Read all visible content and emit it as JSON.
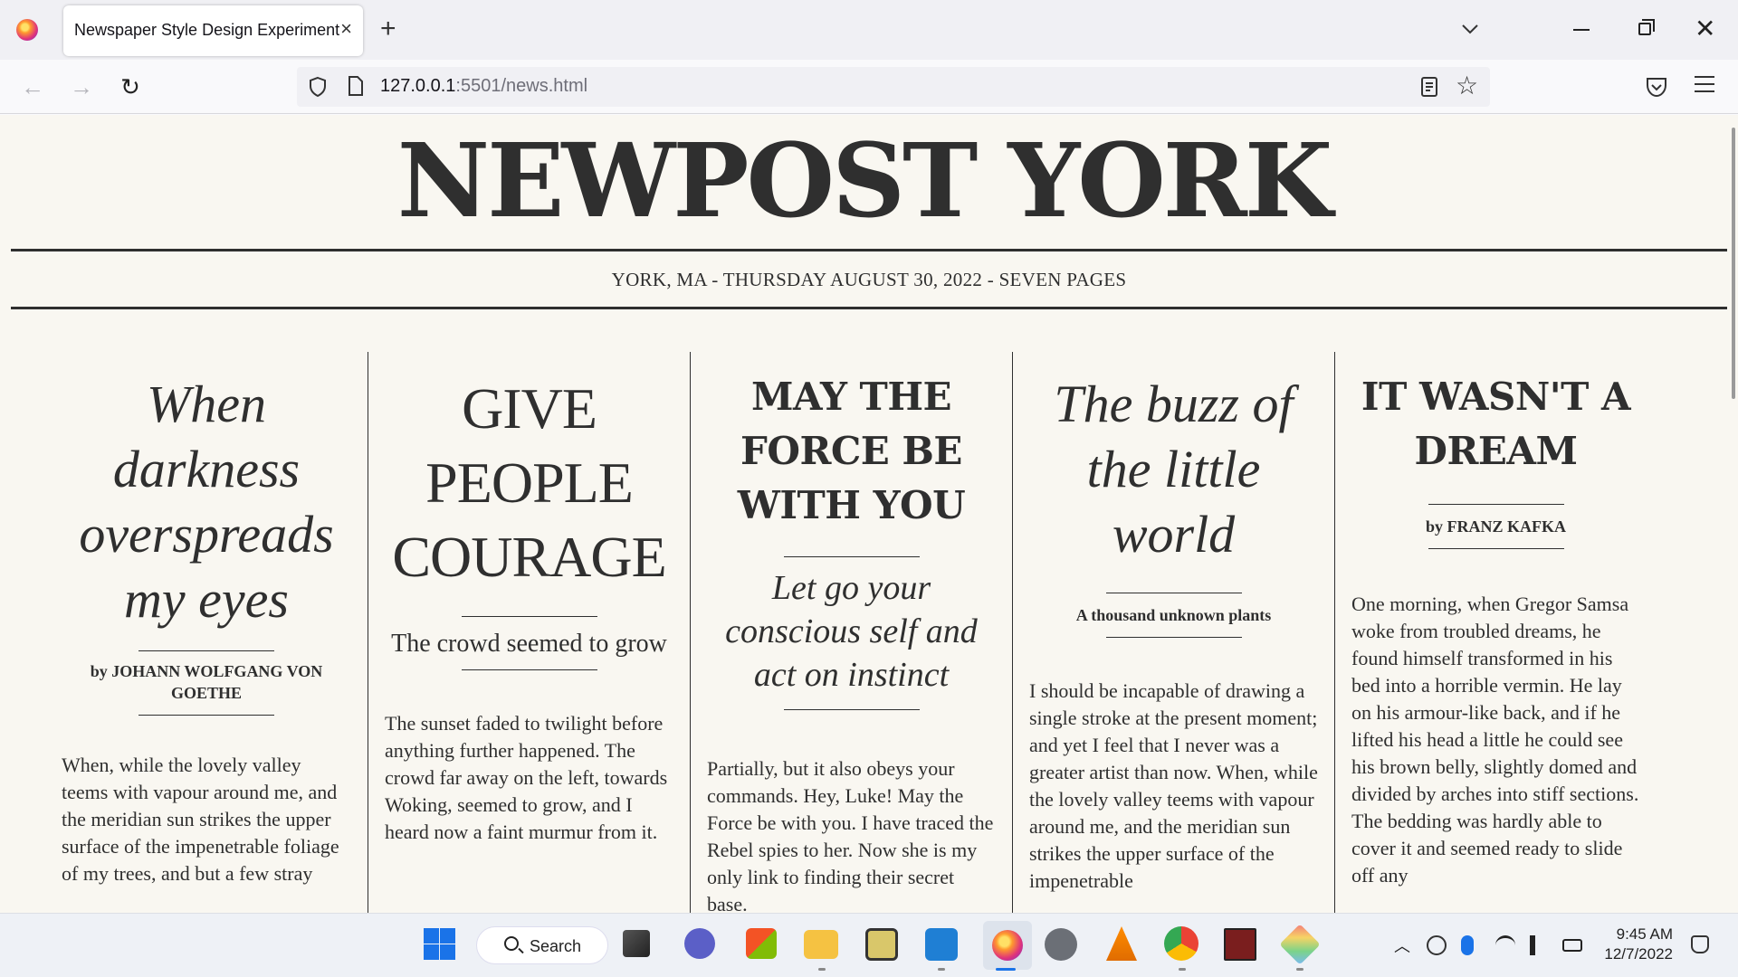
{
  "browser": {
    "tab_title": "Newspaper Style Design Experiment",
    "tab_close": "×",
    "new_tab": "+",
    "url_host": "127.0.0.1",
    "url_rest": ":5501/news.html",
    "window_close": "✕"
  },
  "page": {
    "masthead": "NEWPOST YORK",
    "dateline": "YORK, MA - THURSDAY AUGUST 30, 2022 - SEVEN PAGES",
    "articles": [
      {
        "headline": "When darkness overspreads my eyes",
        "byline": "by JOHANN WOLFGANG VON GOETHE",
        "body": "When, while the lovely valley teems with vapour around me, and the meridian sun strikes the upper surface of the impenetrable foliage of my trees, and but a few stray"
      },
      {
        "headline": "GIVE PEOPLE COURAGE",
        "subhead": "The crowd seemed to grow",
        "body": "The sunset faded to twilight before anything further happened. The crowd far away on the left, towards Woking, seemed to grow, and I heard now a faint murmur from it."
      },
      {
        "headline": "MAY THE FORCE BE WITH YOU",
        "subhead": "Let go your conscious self and act on instinct",
        "body": "Partially, but it also obeys your commands. Hey, Luke! May the Force be with you. I have traced the Rebel spies to her. Now she is my only link to finding their secret base."
      },
      {
        "headline": "The buzz of the little world",
        "subhead": "A thousand unknown plants",
        "body": "I should be incapable of drawing a single stroke at the present moment; and yet I feel that I never was a greater artist than now. When, while the lovely valley teems with vapour around me, and the meridian sun strikes the upper surface of the impenetrable"
      },
      {
        "headline": "IT WASN'T A DREAM",
        "byline": "by FRANZ KAFKA",
        "body": "One morning, when Gregor Samsa woke from troubled dreams, he found himself transformed in his bed into a horrible vermin. He lay on his armour-like back, and if he lifted his head a little he could see his brown belly, slightly domed and divided by arches into stiff sections. The bedding was hardly able to cover it and seemed ready to slide off any"
      }
    ]
  },
  "taskbar": {
    "search_label": "Search",
    "time": "9:45 AM",
    "date": "12/7/2022"
  },
  "icons": [
    "firefox-icon",
    "shield-icon",
    "page-icon",
    "reader-icon",
    "star-icon",
    "pocket-icon",
    "menu-icon",
    "start-icon",
    "search-icon",
    "file-explorer-icon",
    "vscode-icon",
    "settings-icon",
    "vlc-icon",
    "chrome-icon"
  ]
}
